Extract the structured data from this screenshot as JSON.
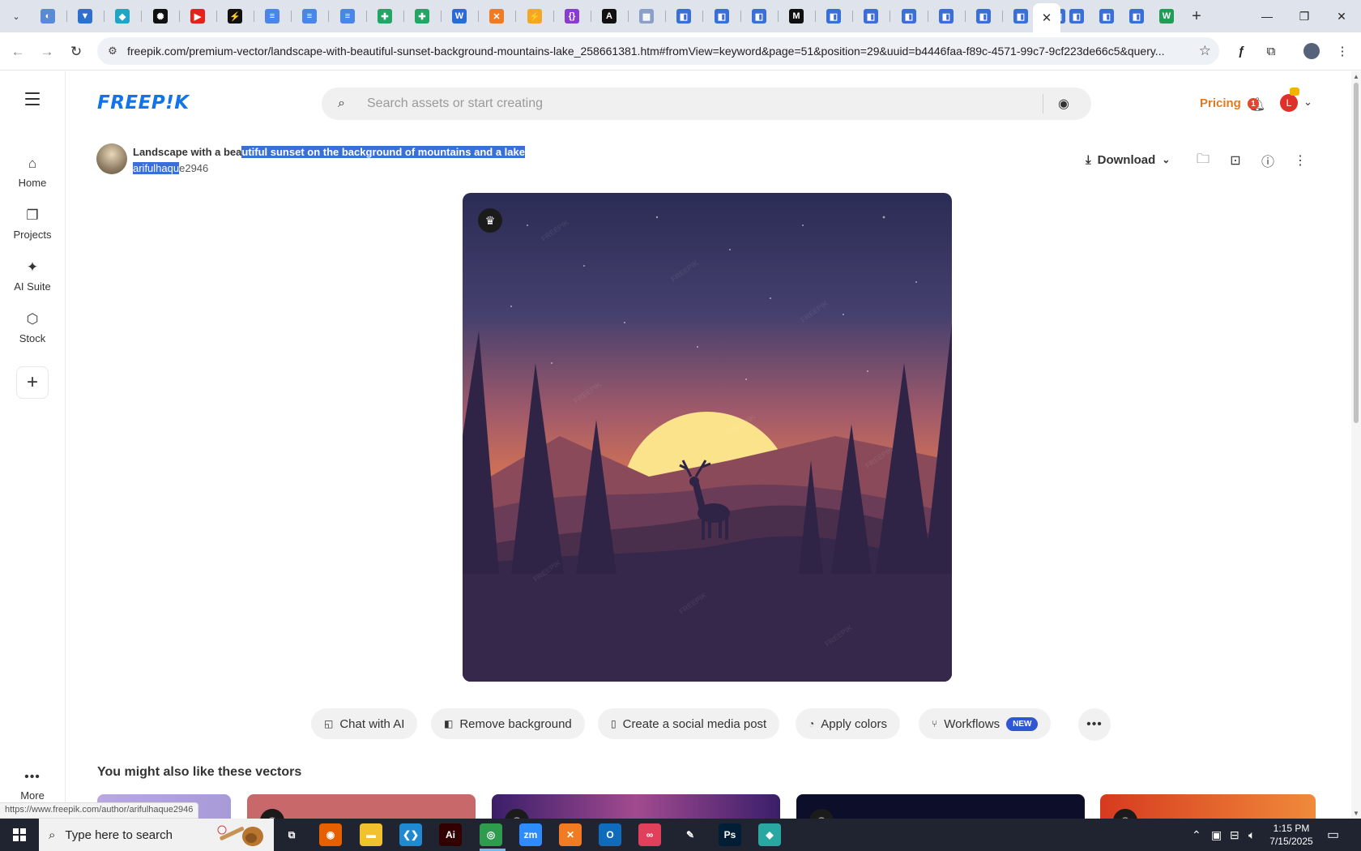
{
  "browser": {
    "tabs": [
      {
        "icon": "globe-icon",
        "glyph": "◐",
        "color": "#5a8ad6"
      },
      {
        "icon": "vpn-icon",
        "glyph": "▼",
        "color": "#2f6fcd"
      },
      {
        "icon": "diamond-icon",
        "glyph": "◆",
        "color": "#1ea6c9"
      },
      {
        "icon": "openai-icon",
        "glyph": "✺",
        "color": "#111111"
      },
      {
        "icon": "youtube-icon",
        "glyph": "▶",
        "color": "#e62117"
      },
      {
        "icon": "bolt-icon",
        "glyph": "⚡",
        "color": "#111111"
      },
      {
        "icon": "docs-icon",
        "glyph": "≡",
        "color": "#4a86e8"
      },
      {
        "icon": "docs-icon",
        "glyph": "≡",
        "color": "#4a86e8"
      },
      {
        "icon": "docs-icon",
        "glyph": "≡",
        "color": "#4a86e8"
      },
      {
        "icon": "sheets-icon",
        "glyph": "✚",
        "color": "#23a566"
      },
      {
        "icon": "sheets-icon",
        "glyph": "✚",
        "color": "#23a566"
      },
      {
        "icon": "word-icon",
        "glyph": "W",
        "color": "#2b6bd8"
      },
      {
        "icon": "xampp-icon",
        "glyph": "✕",
        "color": "#f07b22"
      },
      {
        "icon": "vite-icon",
        "glyph": "⚡",
        "color": "#f5a623"
      },
      {
        "icon": "json-icon",
        "glyph": "{}",
        "color": "#8a3ccf"
      },
      {
        "icon": "ai-icon",
        "glyph": "A",
        "color": "#111111"
      },
      {
        "icon": "image-icon",
        "glyph": "▦",
        "color": "#8aa0c8"
      },
      {
        "icon": "page-icon",
        "glyph": "◧",
        "color": "#3b6fd8"
      },
      {
        "icon": "page-icon",
        "glyph": "◧",
        "color": "#3b6fd8"
      },
      {
        "icon": "page-icon",
        "glyph": "◧",
        "color": "#3b6fd8"
      },
      {
        "icon": "medium-icon",
        "glyph": "M",
        "color": "#111111"
      },
      {
        "icon": "page-icon",
        "glyph": "◧",
        "color": "#3b6fd8"
      },
      {
        "icon": "page-icon",
        "glyph": "◧",
        "color": "#3b6fd8"
      },
      {
        "icon": "page-icon",
        "glyph": "◧",
        "color": "#3b6fd8"
      },
      {
        "icon": "page-icon",
        "glyph": "◧",
        "color": "#3b6fd8"
      },
      {
        "icon": "page-icon",
        "glyph": "◧",
        "color": "#3b6fd8"
      },
      {
        "icon": "page-icon",
        "glyph": "◧",
        "color": "#3b6fd8"
      },
      {
        "icon": "page-icon",
        "glyph": "◧",
        "color": "#3b6fd8"
      }
    ],
    "tabs_after": [
      {
        "icon": "page-icon",
        "glyph": "◧",
        "color": "#3b6fd8"
      },
      {
        "icon": "page-icon",
        "glyph": "◧",
        "color": "#3b6fd8"
      },
      {
        "icon": "page-icon",
        "glyph": "◧",
        "color": "#3b6fd8"
      },
      {
        "icon": "w-icon",
        "glyph": "W",
        "color": "#1f9e55"
      }
    ],
    "active_tab_close": "✕",
    "new_tab": "+",
    "url": "freepik.com/premium-vector/landscape-with-beautiful-sunset-background-mountains-lake_258661381.htm#fromView=keyword&page=51&position=29&uuid=b4446faa-f89c-4571-99c7-9cf223de66c5&query...",
    "status_url": "https://www.freepik.com/author/arifulhaque2946"
  },
  "site": {
    "logo": "FREEP!K",
    "search_placeholder": "Search assets or start creating",
    "pricing": "Pricing",
    "notif_count": "1",
    "user_initial": "L"
  },
  "leftnav": {
    "items": [
      {
        "label": "Home",
        "icon": "home-icon"
      },
      {
        "label": "Projects",
        "icon": "projects-icon"
      },
      {
        "label": "AI Suite",
        "icon": "sparkle-icon"
      },
      {
        "label": "Stock",
        "icon": "stock-icon"
      }
    ],
    "more_label": "More"
  },
  "asset": {
    "title_plain": "Landscape with a bea",
    "title_selected": "utiful sunset on the background of mountains and a lake",
    "author_selected": "arifulhaqu",
    "author_plain": "e2946",
    "download_label": "Download"
  },
  "actions": {
    "chips": [
      {
        "label": "Chat with AI",
        "icon": "chat-icon"
      },
      {
        "label": "Remove background",
        "icon": "remove-bg-icon"
      },
      {
        "label": "Create a social media post",
        "icon": "phone-icon"
      },
      {
        "label": "Apply colors",
        "icon": "palette-icon"
      },
      {
        "label": "Workflows",
        "icon": "workflow-icon",
        "badge": "NEW"
      }
    ]
  },
  "related": {
    "title": "You might also like these vectors"
  },
  "taskbar": {
    "search_placeholder": "Type here to search",
    "time": "1:15 PM",
    "date": "7/15/2025",
    "apps": [
      {
        "icon": "task-view-icon",
        "glyph": "⧉",
        "color": "#1f2430"
      },
      {
        "icon": "firefox-icon",
        "glyph": "◉",
        "color": "#e66000"
      },
      {
        "icon": "file-explorer-icon",
        "glyph": "▬",
        "color": "#f2c12e"
      },
      {
        "icon": "vscode-icon",
        "glyph": "❮❯",
        "color": "#1f8ad2"
      },
      {
        "icon": "illustrator-icon",
        "glyph": "Ai",
        "color": "#330000"
      },
      {
        "icon": "chrome-icon",
        "glyph": "◎",
        "color": "#2f9b4f"
      },
      {
        "icon": "zoom-icon",
        "glyph": "zm",
        "color": "#2d8cff"
      },
      {
        "icon": "xampp-icon",
        "glyph": "✕",
        "color": "#f07b22"
      },
      {
        "icon": "outlook-icon",
        "glyph": "O",
        "color": "#0f6cbd"
      },
      {
        "icon": "creative-cloud-icon",
        "glyph": "∞",
        "color": "#e0405c"
      },
      {
        "icon": "pen-icon",
        "glyph": "✎",
        "color": "#1f2430"
      },
      {
        "icon": "photoshop-icon",
        "glyph": "Ps",
        "color": "#001e36"
      },
      {
        "icon": "app-icon",
        "glyph": "◆",
        "color": "#2aa7a0"
      }
    ]
  }
}
